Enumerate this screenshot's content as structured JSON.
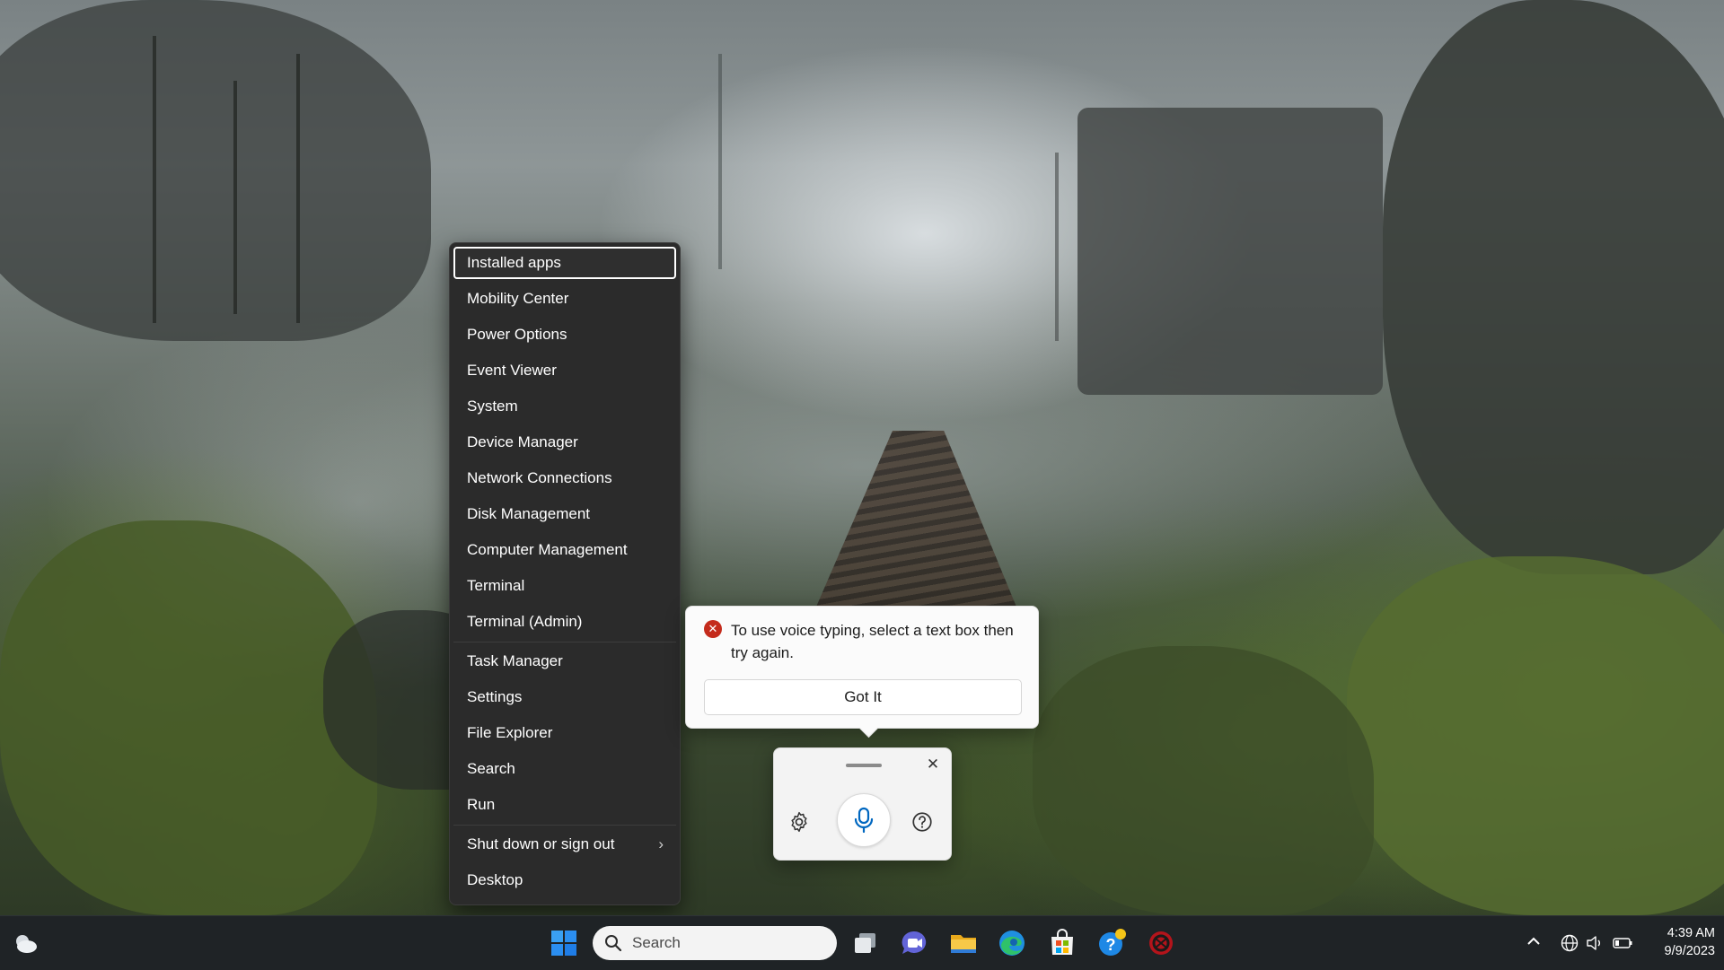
{
  "menu": {
    "items": [
      {
        "label": "Installed apps"
      },
      {
        "label": "Mobility Center"
      },
      {
        "label": "Power Options"
      },
      {
        "label": "Event Viewer"
      },
      {
        "label": "System"
      },
      {
        "label": "Device Manager"
      },
      {
        "label": "Network Connections"
      },
      {
        "label": "Disk Management"
      },
      {
        "label": "Computer Management"
      },
      {
        "label": "Terminal"
      },
      {
        "label": "Terminal (Admin)"
      },
      {
        "label": "Task Manager"
      },
      {
        "label": "Settings"
      },
      {
        "label": "File Explorer"
      },
      {
        "label": "Search"
      },
      {
        "label": "Run"
      },
      {
        "label": "Shut down or sign out"
      },
      {
        "label": "Desktop"
      }
    ],
    "focused_item": "Installed apps",
    "submenu_arrow": "›"
  },
  "voice_callout": {
    "message": "To use voice typing, select a text box then try again.",
    "button_label": "Got It",
    "error_icon": "x-circle-icon",
    "error_color": "#c42b1c"
  },
  "voice_widget": {
    "close_glyph": "✕",
    "icons": [
      "settings-gear-icon",
      "microphone-icon",
      "help-icon",
      "close-icon"
    ],
    "mic_color": "#0067c0"
  },
  "taskbar": {
    "search_placeholder": "Search",
    "pinned_icons": [
      "windows-start-icon",
      "task-view-icon",
      "teams-chat-icon",
      "file-explorer-icon",
      "edge-browser-icon",
      "microsoft-store-icon",
      "get-help-icon",
      "security-app-icon"
    ],
    "tray_icons": [
      "show-hidden-icons-chevron",
      "language-globe-icon",
      "volume-icon",
      "battery-icon"
    ],
    "clock": {
      "time": "4:39 AM",
      "date": "9/9/2023"
    }
  }
}
